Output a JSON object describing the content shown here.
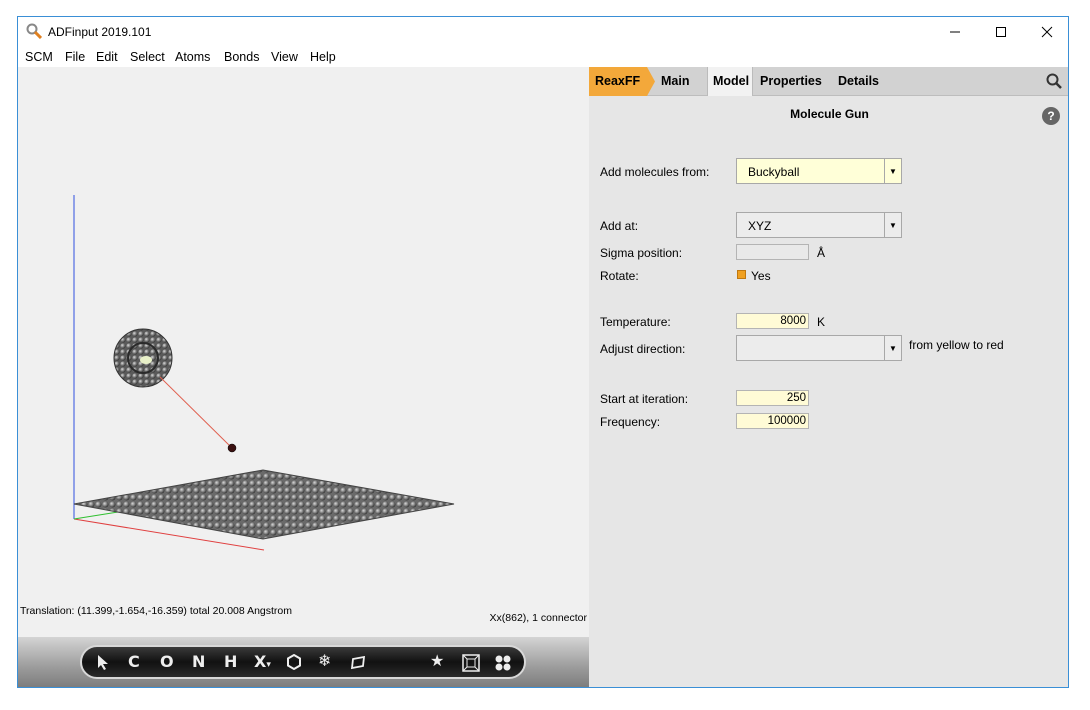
{
  "window": {
    "title": "ADFinput 2019.101"
  },
  "menu": [
    "SCM",
    "File",
    "Edit",
    "Select",
    "Atoms",
    "Bonds",
    "View",
    "Help"
  ],
  "viewport": {
    "status_left": "Translation: (11.399,-1.654,-16.359) total 20.008 Angstrom",
    "status_right": "Xx(862), 1 connector"
  },
  "toolbar": {
    "tools": [
      "C",
      "O",
      "N",
      "H",
      "X"
    ]
  },
  "panel": {
    "tabs": {
      "reaxff": "ReaxFF",
      "main": "Main",
      "model": "Model",
      "properties": "Properties",
      "details": "Details"
    },
    "heading": "Molecule Gun",
    "add_molecules_label": "Add molecules from:",
    "add_molecules_value": "Buckyball",
    "add_at_label": "Add at:",
    "add_at_value": "XYZ",
    "sigma_label": "Sigma position:",
    "sigma_value": "",
    "sigma_unit": "Å",
    "rotate_label": "Rotate:",
    "rotate_value": "Yes",
    "temperature_label": "Temperature:",
    "temperature_value": "8000",
    "temperature_unit": "K",
    "adjust_label": "Adjust direction:",
    "adjust_value": "",
    "adjust_note": "from yellow to red",
    "start_label": "Start at iteration:",
    "start_value": "250",
    "frequency_label": "Frequency:",
    "frequency_value": "100000"
  },
  "colors": {
    "accent": "#f3a83a",
    "axis_x": "#e04040",
    "axis_y": "#3050e0",
    "axis_z": "#30c030"
  }
}
